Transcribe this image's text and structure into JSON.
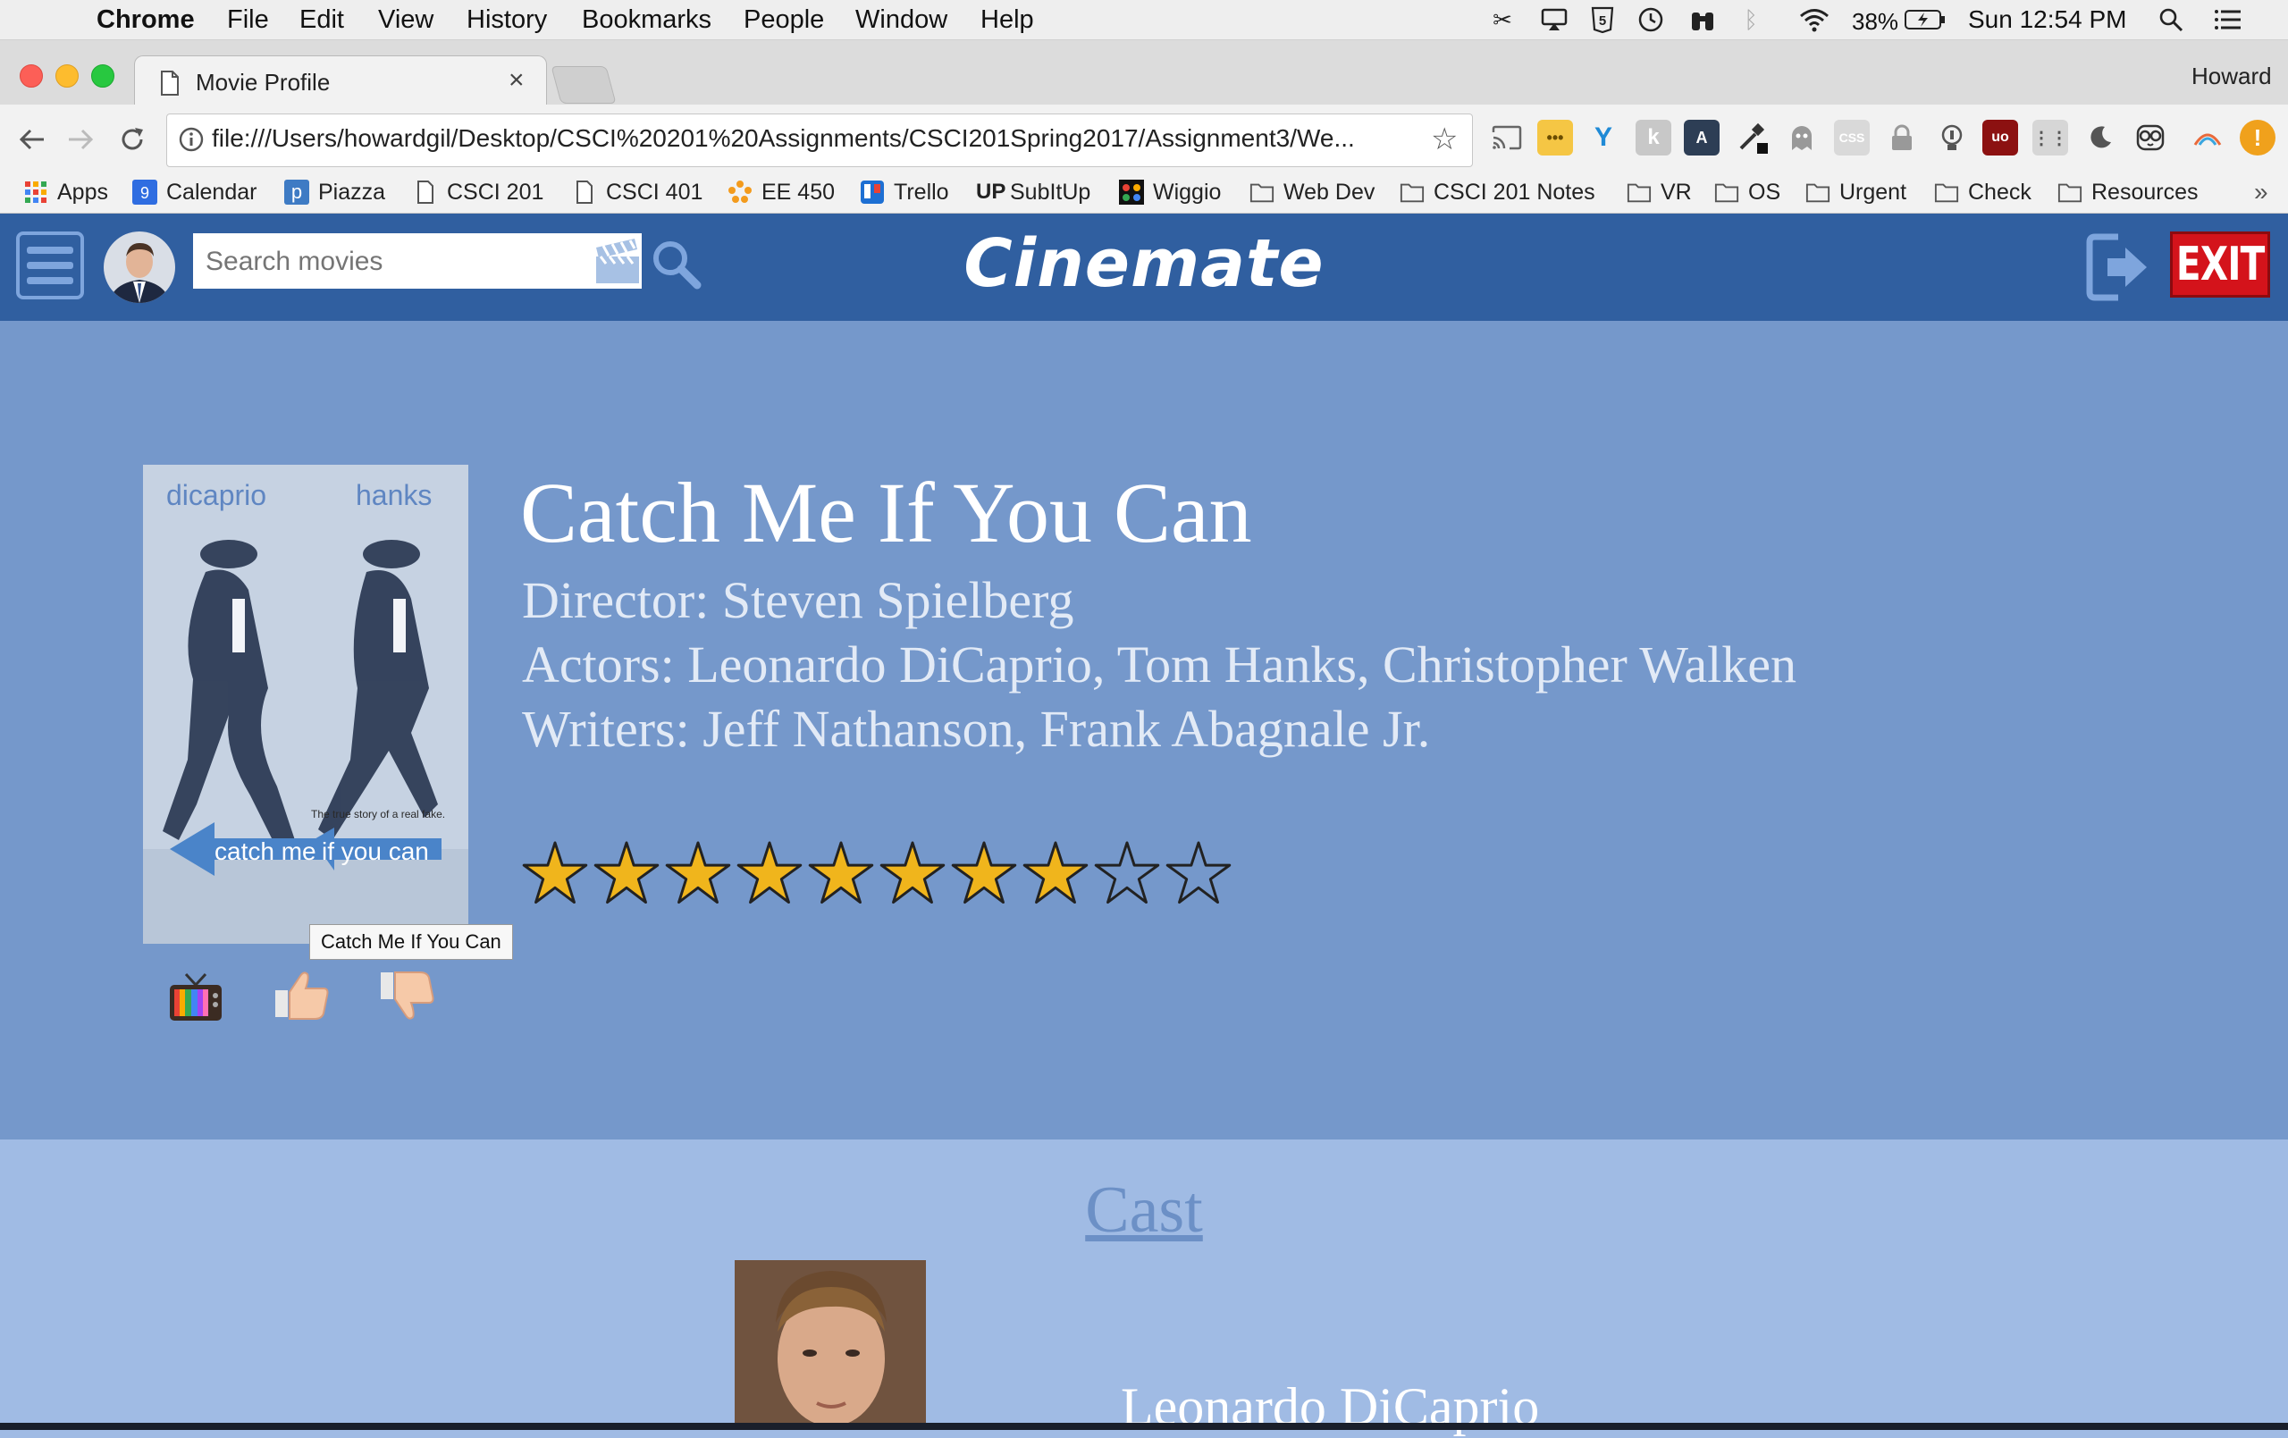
{
  "menubar": {
    "app_name": "Chrome",
    "menus": [
      "File",
      "Edit",
      "View",
      "History",
      "Bookmarks",
      "People",
      "Window",
      "Help"
    ],
    "battery": "38%",
    "clock": "Sun 12:54 PM"
  },
  "browser": {
    "tab_title": "Movie Profile",
    "tab_close": "×",
    "profile_name": "Howard",
    "url": "file:///Users/howardgil/Desktop/CSCI%20201%20Assignments/CSCI201Spring2017/Assignment3/We...",
    "bookmarks": [
      "Apps",
      "Calendar",
      "Piazza",
      "CSCI 201",
      "CSCI 401",
      "EE 450",
      "Trello",
      "SubItUp",
      "Wiggio",
      "Web Dev",
      "CSCI 201 Notes",
      "VR",
      "OS",
      "Urgent",
      "Check",
      "Resources"
    ],
    "bookmarks_overflow": "»",
    "calendar_badge": "9"
  },
  "site": {
    "brand": "Cinemate",
    "search_placeholder": "Search movies",
    "exit_label": "EXIT"
  },
  "movie": {
    "title": "Catch Me If You Can",
    "director": "Director: Steven Spielberg",
    "actors": "Actors: Leonardo DiCaprio, Tom Hanks, Christopher Walken",
    "writers": "Writers: Jeff Nathanson, Frank Abagnale Jr.",
    "rating_filled": 8,
    "rating_max": 10,
    "tooltip": "Catch Me If You Can",
    "poster": {
      "actor_left": "dicaprio",
      "actor_right": "hanks",
      "title_left": "catch me",
      "title_right": "if you can",
      "tagline": "The true story of a real fake."
    }
  },
  "cast": {
    "heading": "Cast",
    "members": [
      {
        "name": "Leonardo DiCaprio"
      }
    ]
  },
  "colors": {
    "header_bg": "#305fa0",
    "hero_bg": "#7598cb",
    "cast_bg": "#a0bbe4",
    "star_fill": "#f0b51c",
    "exit_red": "#d4131b"
  }
}
